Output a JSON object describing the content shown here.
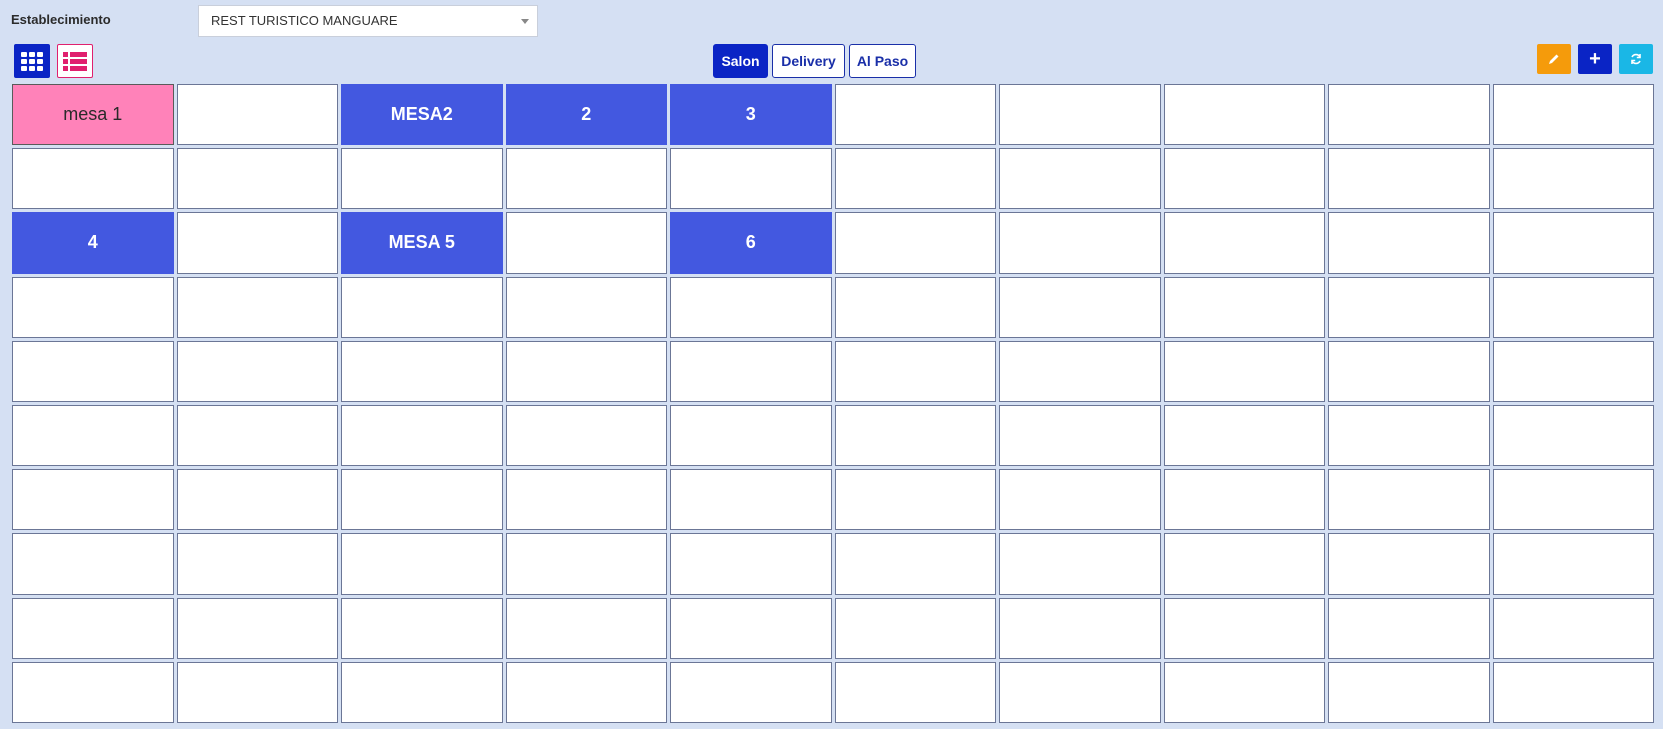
{
  "header": {
    "establishment_label": "Establecimiento",
    "establishment_value": "REST TURISTICO MANGUARE"
  },
  "view_toggle": {
    "grid_icon": "grid-icon",
    "list_icon": "list-icon"
  },
  "tabs": [
    {
      "label": "Salon",
      "active": true
    },
    {
      "label": "Delivery",
      "active": false
    },
    {
      "label": "Al Paso",
      "active": false
    }
  ],
  "actions": {
    "edit_icon": "pencil-icon",
    "add_label": "+",
    "refresh_icon": "refresh-icon"
  },
  "colors": {
    "occupied": "#ff82b9",
    "available": "#4358e0",
    "empty": "#ffffff",
    "primary": "#0a24c5",
    "warning": "#f59b0b",
    "info": "#1ab7e6"
  },
  "tables": {
    "columns": 10,
    "rows": 10,
    "cells": [
      {
        "row": 0,
        "col": 0,
        "label": "mesa 1",
        "state": "pink"
      },
      {
        "row": 0,
        "col": 2,
        "label": "MESA2",
        "state": "blue"
      },
      {
        "row": 0,
        "col": 3,
        "label": "2",
        "state": "blue"
      },
      {
        "row": 0,
        "col": 4,
        "label": "3",
        "state": "blue"
      },
      {
        "row": 2,
        "col": 0,
        "label": "4",
        "state": "blue"
      },
      {
        "row": 2,
        "col": 2,
        "label": "MESA 5",
        "state": "blue"
      },
      {
        "row": 2,
        "col": 4,
        "label": "6",
        "state": "blue"
      }
    ]
  }
}
